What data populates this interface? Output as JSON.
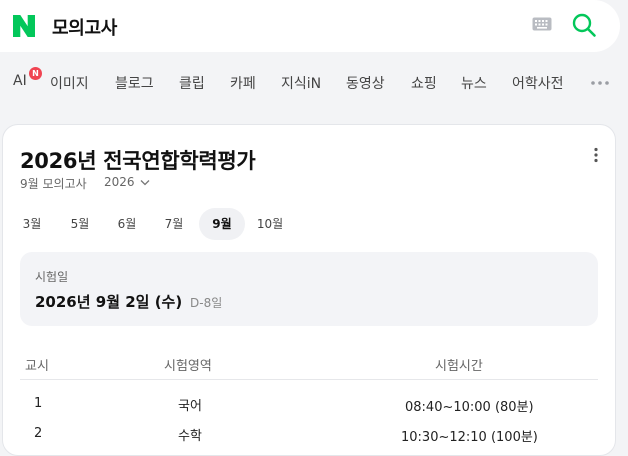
{
  "search": {
    "query": "모의고사"
  },
  "tabs": [
    {
      "label": "AI",
      "badge": "N"
    },
    {
      "label": "이미지"
    },
    {
      "label": "블로그"
    },
    {
      "label": "클립"
    },
    {
      "label": "카페"
    },
    {
      "label": "지식iN"
    },
    {
      "label": "동영상"
    },
    {
      "label": "쇼핑"
    },
    {
      "label": "뉴스"
    },
    {
      "label": "어학사전"
    }
  ],
  "card": {
    "title": "2026년 전국연합학력평가",
    "subtitle": "9월 모의고사",
    "year": "2026",
    "months": [
      "3월",
      "5월",
      "6월",
      "7월",
      "9월",
      "10월"
    ],
    "selected_month": "9월",
    "exam_info": {
      "label": "시험일",
      "date": "2026년 9월 2일 (수)",
      "dday": "D-8일"
    },
    "table": {
      "headers": [
        "교시",
        "시험영역",
        "시험시간"
      ],
      "rows": [
        [
          "1",
          "국어",
          "08:40~10:00 (80분)"
        ],
        [
          "2",
          "수학",
          "10:30~12:10 (100분)"
        ]
      ]
    }
  },
  "colors": {
    "brand_green": "#03c75a",
    "badge_red": "#f04452",
    "page_background": "#f3f4f6"
  },
  "icons": {
    "logo": "naver-n-logo-icon",
    "keyboard": "keyboard-icon",
    "search": "search-icon",
    "more_tabs": "more-dots-icon",
    "card_menu": "kebab-menu-icon",
    "year_dropdown": "chevron-down-icon"
  }
}
